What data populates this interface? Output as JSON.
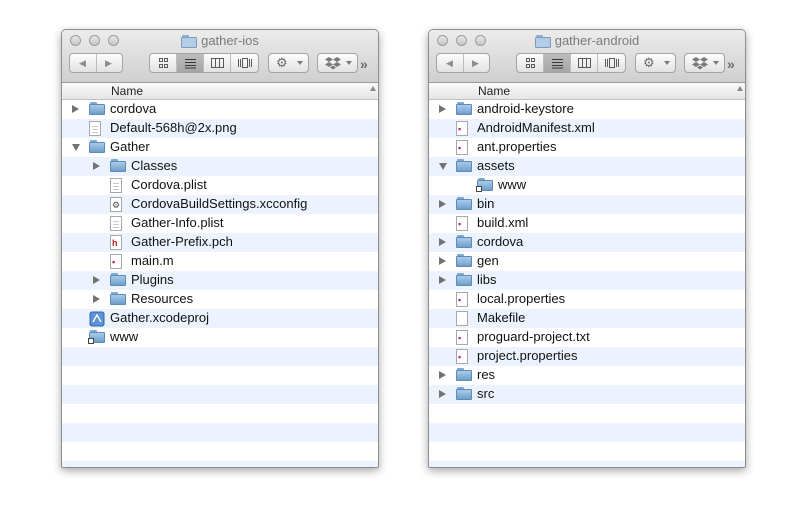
{
  "windows": [
    {
      "title": "gather-ios",
      "column_header": "Name",
      "rows": [
        {
          "name": "cordova",
          "icon": "folder-icon",
          "disclosure": "closed",
          "level": 0
        },
        {
          "name": "Default-568h@2x.png",
          "icon": "image-file-icon",
          "disclosure": "none",
          "level": 0
        },
        {
          "name": "Gather",
          "icon": "folder-icon",
          "disclosure": "open",
          "level": 0
        },
        {
          "name": "Classes",
          "icon": "folder-icon",
          "disclosure": "closed",
          "level": 1
        },
        {
          "name": "Cordova.plist",
          "icon": "plist-file-icon",
          "disclosure": "none",
          "level": 1
        },
        {
          "name": "CordovaBuildSettings.xcconfig",
          "icon": "xcconfig-file-icon",
          "disclosure": "none",
          "level": 1
        },
        {
          "name": "Gather-Info.plist",
          "icon": "plist-file-icon",
          "disclosure": "none",
          "level": 1
        },
        {
          "name": "Gather-Prefix.pch",
          "icon": "header-file-icon",
          "disclosure": "none",
          "level": 1
        },
        {
          "name": "main.m",
          "icon": "source-file-icon",
          "disclosure": "none",
          "level": 1
        },
        {
          "name": "Plugins",
          "icon": "folder-icon",
          "disclosure": "closed",
          "level": 1
        },
        {
          "name": "Resources",
          "icon": "folder-icon",
          "disclosure": "closed",
          "level": 1
        },
        {
          "name": "Gather.xcodeproj",
          "icon": "xcodeproj-icon",
          "disclosure": "none",
          "level": 0
        },
        {
          "name": "www",
          "icon": "folder-alias-icon",
          "disclosure": "none",
          "level": 0
        }
      ]
    },
    {
      "title": "gather-android",
      "column_header": "Name",
      "rows": [
        {
          "name": "android-keystore",
          "icon": "folder-icon",
          "disclosure": "closed",
          "level": 0
        },
        {
          "name": "AndroidManifest.xml",
          "icon": "xml-file-icon",
          "disclosure": "none",
          "level": 0
        },
        {
          "name": "ant.properties",
          "icon": "properties-file-icon",
          "disclosure": "none",
          "level": 0
        },
        {
          "name": "assets",
          "icon": "folder-icon",
          "disclosure": "open",
          "level": 0
        },
        {
          "name": "www",
          "icon": "folder-alias-icon",
          "disclosure": "none",
          "level": 1
        },
        {
          "name": "bin",
          "icon": "folder-icon",
          "disclosure": "closed",
          "level": 0
        },
        {
          "name": "build.xml",
          "icon": "xml-file-icon",
          "disclosure": "none",
          "level": 0
        },
        {
          "name": "cordova",
          "icon": "folder-icon",
          "disclosure": "closed",
          "level": 0
        },
        {
          "name": "gen",
          "icon": "folder-icon",
          "disclosure": "closed",
          "level": 0
        },
        {
          "name": "libs",
          "icon": "folder-icon",
          "disclosure": "closed",
          "level": 0
        },
        {
          "name": "local.properties",
          "icon": "properties-file-icon",
          "disclosure": "none",
          "level": 0
        },
        {
          "name": "Makefile",
          "icon": "blank-file-icon",
          "disclosure": "none",
          "level": 0
        },
        {
          "name": "proguard-project.txt",
          "icon": "text-file-icon",
          "disclosure": "none",
          "level": 0
        },
        {
          "name": "project.properties",
          "icon": "properties-file-icon",
          "disclosure": "none",
          "level": 0
        },
        {
          "name": "res",
          "icon": "folder-icon",
          "disclosure": "closed",
          "level": 0
        },
        {
          "name": "src",
          "icon": "folder-icon",
          "disclosure": "closed",
          "level": 0
        }
      ]
    }
  ],
  "toolbar": {
    "back_icon": "back-arrow-icon",
    "forward_icon": "forward-arrow-icon",
    "view_modes": [
      "icon-view-icon",
      "list-view-icon",
      "column-view-icon",
      "coverflow-view-icon"
    ],
    "selected_view": "list-view-icon",
    "action_icon": "gear-icon",
    "dropbox_icon": "dropbox-icon",
    "overflow_icon": "chevron-double-right-icon"
  },
  "colors": {
    "stripe": "#edf3fe",
    "folder": "#8fb7dd",
    "title_text": "#7a7a7a"
  }
}
